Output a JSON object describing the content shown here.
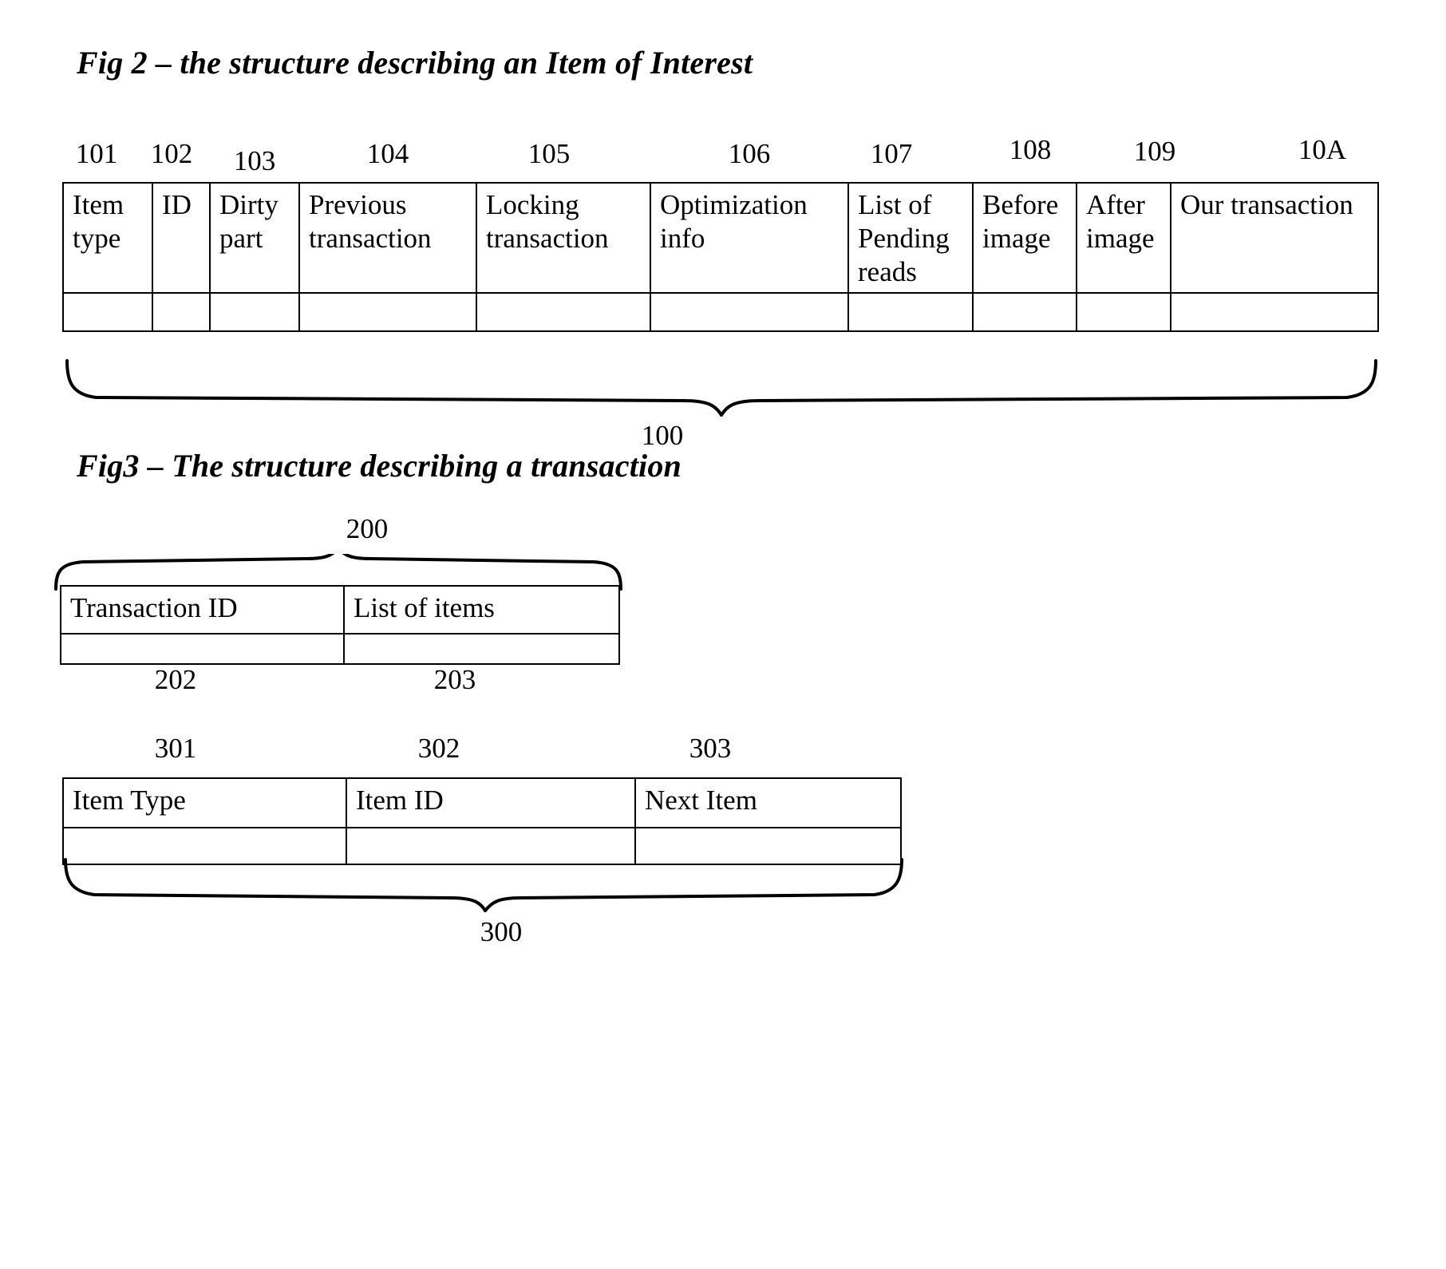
{
  "figures": [
    {
      "id": "fig2",
      "title": "Fig 2 – the structure describing an Item of Interest",
      "overall_ref": "100",
      "column_refs": [
        "101",
        "102",
        "103",
        "104",
        "105",
        "106",
        "107",
        "108",
        "109",
        "10A"
      ],
      "columns": [
        "Item type",
        "ID",
        "Dirty part",
        "Previous transaction",
        "Locking transaction",
        "Optimization info",
        "List of Pending reads",
        "Before image",
        "After image",
        "Our transaction"
      ],
      "values": [
        "",
        "",
        "",
        "",
        "",
        "",
        "",
        "",
        "",
        ""
      ]
    },
    {
      "id": "fig3",
      "title": "Fig3 – The structure describing a transaction",
      "transaction_struct": {
        "overall_ref": "200",
        "column_refs": [
          "202",
          "203"
        ],
        "columns": [
          "Transaction ID",
          "List of items"
        ],
        "values": [
          "",
          ""
        ]
      },
      "item_struct": {
        "overall_ref": "300",
        "column_refs": [
          "301",
          "302",
          "303"
        ],
        "columns": [
          "Item Type",
          "Item ID",
          "Next Item"
        ],
        "values": [
          "",
          "",
          ""
        ]
      }
    }
  ],
  "colors": {
    "ink": "#000000",
    "paper": "#ffffff"
  }
}
